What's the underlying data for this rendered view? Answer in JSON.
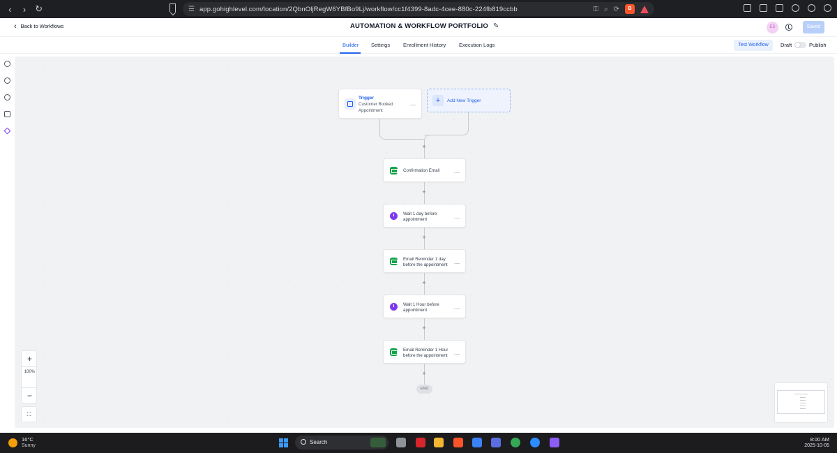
{
  "browser": {
    "url": "app.gohighlevel.com/location/2QbnOljRegW6YBfBo9Lj/workflow/cc1f4399-8adc-4cee-880c-224fb819ccbb",
    "back_icon": "chevron-left-icon",
    "forward_icon": "chevron-right-icon",
    "reload_icon": "reload-icon"
  },
  "header": {
    "back_label": "Back to Workflows",
    "title": "AUTOMATION & WORKFLOW PORTFOLIO",
    "avatar_initials": "ES",
    "saved_label": "Saved"
  },
  "tabs": [
    {
      "label": "Builder",
      "active": true
    },
    {
      "label": "Settings",
      "active": false
    },
    {
      "label": "Enrollment History",
      "active": false
    },
    {
      "label": "Execution Logs",
      "active": false
    }
  ],
  "toolbar": {
    "test_label": "Test Workflow",
    "draft_label": "Draft",
    "publish_label": "Publish",
    "publish_enabled": false
  },
  "workflow": {
    "trigger": {
      "title": "Trigger",
      "name": "Customer Booked Appointment"
    },
    "add_trigger_label": "Add New Trigger",
    "actions": [
      {
        "type": "email",
        "label": "Confirmation Email"
      },
      {
        "type": "wait",
        "label": "Wait 1 day before appointment"
      },
      {
        "type": "email",
        "label": "Email Reminder 1 day before the appointment"
      },
      {
        "type": "wait",
        "label": "Wait 1 Hour before appointment"
      },
      {
        "type": "email",
        "label": "Email Reminder 1 Hour before the appointment"
      }
    ],
    "end_label": "END"
  },
  "zoom": {
    "plus": "+",
    "level": "100%",
    "minus": "−",
    "fit_icon": "fit-screen-icon"
  },
  "taskbar": {
    "temperature": "16°C",
    "condition": "Sunny",
    "search_label": "Search",
    "time": "8:00 AM",
    "date": "2025-10-05"
  },
  "colors": {
    "accent": "#2563eb",
    "email_icon": "#16a34a",
    "wait_icon": "#7c3aed"
  }
}
